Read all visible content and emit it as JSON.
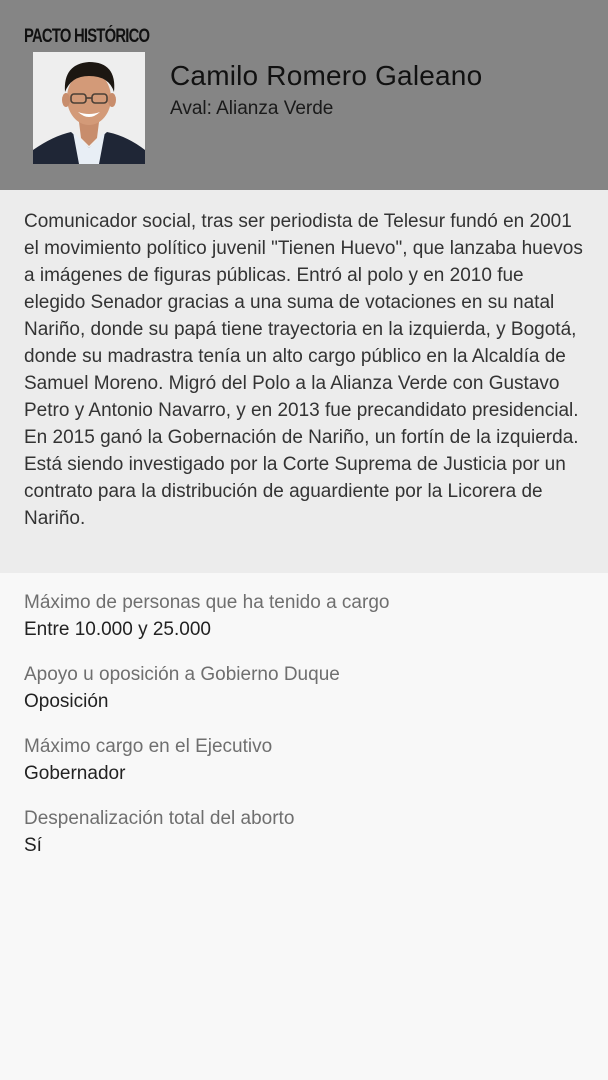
{
  "header": {
    "party": "PACTO HISTÓRICO",
    "name": "Camilo Romero Galeano",
    "aval": "Aval: Alianza Verde"
  },
  "bio": "Comunicador social, tras ser periodista de Telesur fundó en 2001 el movimiento político juvenil \"Tienen Huevo\", que lanzaba huevos a imágenes de figuras públicas. Entró al polo y en 2010 fue elegido Senador gracias a una suma de votaciones en su natal Nariño, donde su papá tiene trayectoria en la izquierda, y Bogotá, donde su madrastra tenía un alto cargo público en la Alcaldía de Samuel Moreno. Migró del Polo a la Alianza Verde con Gustavo Petro y Antonio Navarro, y en 2013 fue precandidato presidencial. En 2015 ganó la Gobernación de Nariño, un fortín de la izquierda. Está siendo investigado por la Corte Suprema de Justicia por un contrato para la distribución de aguardiente por la Licorera de Nariño.",
  "facts": [
    {
      "label": "Máximo de personas que ha tenido a cargo",
      "value": "Entre 10.000 y 25.000"
    },
    {
      "label": "Apoyo u oposición a Gobierno Duque",
      "value": "Oposición"
    },
    {
      "label": "Máximo cargo en el Ejecutivo",
      "value": "Gobernador"
    },
    {
      "label": "Despenalización total del aborto",
      "value": "Sí"
    }
  ]
}
